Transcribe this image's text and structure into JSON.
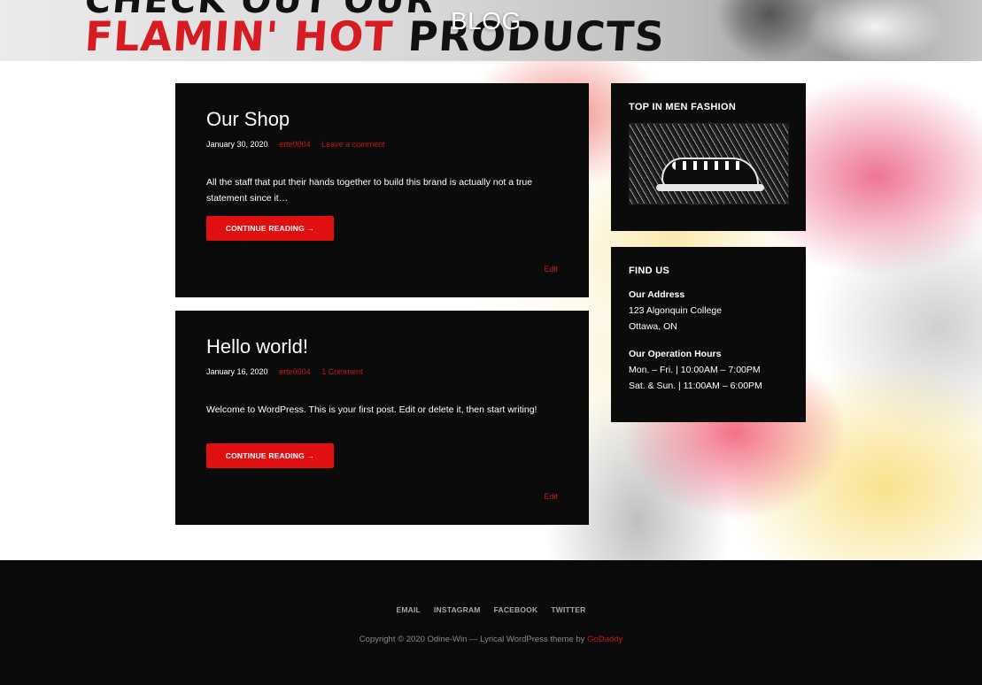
{
  "header": {
    "banner_top": "CHECK OUT OUR",
    "banner_red": "FLAMIN' HOT",
    "banner_black": "PRODUCTS",
    "page_title": "BLOG"
  },
  "posts": [
    {
      "title": "Our Shop",
      "date": "January 30, 2020",
      "author": "erte0004",
      "comments": "Leave a comment",
      "excerpt": "All the staff that put their hands together to build this brand is actually not a true statement since it…",
      "read_more": "CONTINUE READING →",
      "edit": "Edit"
    },
    {
      "title": "Hello world!",
      "date": "January 16, 2020",
      "author": "erte0004",
      "comments": "1 Comment",
      "excerpt": "Welcome to WordPress. This is your first post. Edit or delete it, then start writing!",
      "read_more": "CONTINUE READING →",
      "edit": "Edit"
    }
  ],
  "sidebar": {
    "fashion_title": "TOP IN MEN FASHION",
    "find_us": {
      "title": "FIND US",
      "address_label": "Our Address",
      "address_line1": "123 Algonquin College",
      "address_line2": "Ottawa, ON",
      "hours_label": "Our Operation Hours",
      "hours_line1": "Mon. – Fri. | 10:00AM – 7:00PM",
      "hours_line2": "Sat. & Sun. | 11:00AM – 6:00PM"
    }
  },
  "footer": {
    "nav": [
      "EMAIL",
      "INSTAGRAM",
      "FACEBOOK",
      "TWITTER"
    ],
    "copyright_text": "Copyright © 2020 Odine-Win — Lyrical WordPress theme by ",
    "copyright_link": "GoDaddy"
  },
  "colors": {
    "accent": "#e01010",
    "link": "#c21a1a",
    "panel": "#0b0b0b"
  }
}
